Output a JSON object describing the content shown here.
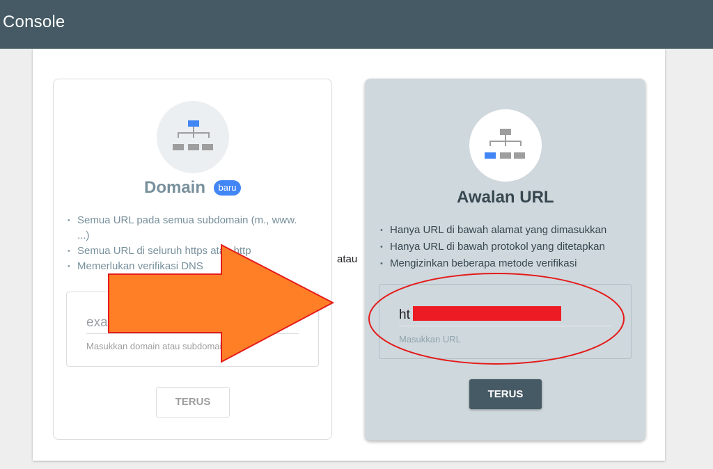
{
  "header": {
    "title": "Console"
  },
  "domain_card": {
    "title": "Domain",
    "badge": "baru",
    "bullets": [
      "Semua URL pada semua subdomain (m., www. ...)",
      "Semua URL di seluruh https atau http",
      "Memerlukan verifikasi DNS"
    ],
    "input_placeholder": "example.com",
    "input_helper": "Masukkan domain atau subdomain",
    "button_label": "TERUS"
  },
  "separator": {
    "label": "atau"
  },
  "url_prefix_card": {
    "title": "Awalan URL",
    "bullets": [
      "Hanya URL di bawah alamat yang dimasukkan",
      "Hanya URL di bawah protokol yang ditetapkan",
      "Mengizinkan beberapa metode verifikasi"
    ],
    "input_value": "ht",
    "input_helper": "Masukkan URL",
    "button_label": "TERUS"
  },
  "annotations": {
    "arrow_color": "#ff7f27",
    "arrow_outline": "#e41b1b",
    "ellipse_color": "#e41b1b",
    "redaction_color": "#ed1c24"
  },
  "colors": {
    "topbar": "#455a64",
    "accent": "#4285f4",
    "selected_card": "#cfd8dc"
  }
}
